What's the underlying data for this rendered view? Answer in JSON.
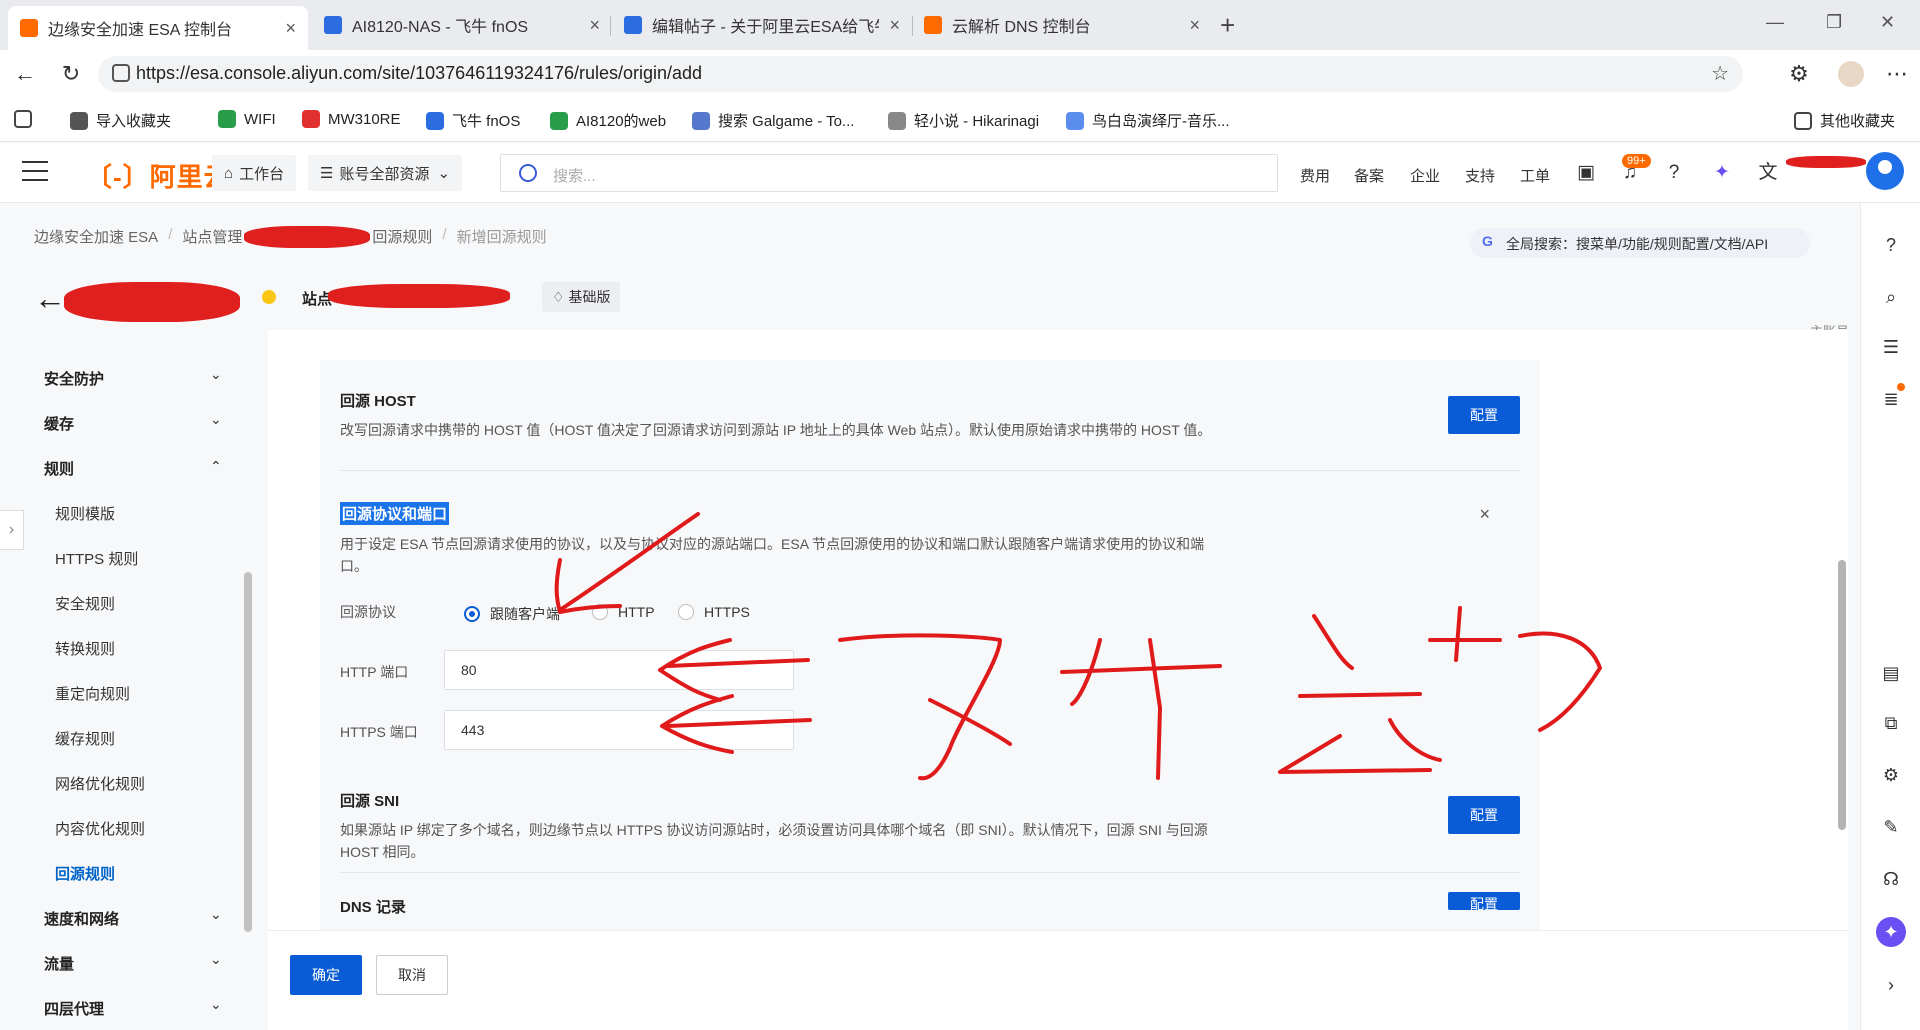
{
  "browser": {
    "tabs": [
      {
        "title": "边缘安全加速 ESA 控制台",
        "color": "#ff6a00",
        "active": true
      },
      {
        "title": "AI8120-NAS - 飞牛 fnOS",
        "color": "#2b6de0",
        "active": false
      },
      {
        "title": "编辑帖子 - 关于阿里云ESA给飞牛N",
        "color": "#2b6de0",
        "active": false
      },
      {
        "title": "云解析 DNS 控制台",
        "color": "#ff6a00",
        "active": false
      }
    ],
    "url": "https://esa.console.aliyun.com/site/1037646119324176/rules/origin/add",
    "bookmarks": [
      {
        "label": "导入收藏夹",
        "color": "#555555"
      },
      {
        "label": "WIFI",
        "color": "#2a9d4b"
      },
      {
        "label": "MW310RE",
        "color": "#e03030"
      },
      {
        "label": "飞牛 fnOS",
        "color": "#2b6de0"
      },
      {
        "label": "AI8120的web",
        "color": "#2a9d4b"
      },
      {
        "label": "搜索 Galgame - To...",
        "color": "#5577cc"
      },
      {
        "label": "轻小说 - Hikarinagi",
        "color": "#888888"
      },
      {
        "label": "鸟白岛演绎厅-音乐...",
        "color": "#5b8def"
      }
    ],
    "bookmarks_other": "其他收藏夹"
  },
  "header": {
    "logo": "〔-〕阿里云",
    "workbench": "工作台",
    "resources": "账号全部资源",
    "search_placeholder": "搜索...",
    "links": [
      "费用",
      "备案",
      "企业",
      "支持",
      "工单"
    ],
    "badge": "99+",
    "subaccount": "主账号",
    "accent": "#ff6a00"
  },
  "breadcrumb": {
    "items": [
      "边缘安全加速 ESA",
      "站点管理",
      "回源规则",
      "新增回源规则"
    ],
    "global_search": "全局搜索：搜菜单/功能/规则配置/文档/API"
  },
  "title": {
    "site_label": "站点",
    "plan": "基础版"
  },
  "sidenav": {
    "sections": [
      {
        "label": "安全防护",
        "expanded": false
      },
      {
        "label": "缓存",
        "expanded": false
      },
      {
        "label": "规则",
        "expanded": true
      },
      {
        "label": "速度和网络",
        "expanded": false
      },
      {
        "label": "流量",
        "expanded": false
      },
      {
        "label": "四层代理",
        "expanded": false
      }
    ],
    "rule_items": [
      "规则模版",
      "HTTPS 规则",
      "安全规则",
      "转换规则",
      "重定向规则",
      "缓存规则",
      "网络优化规则",
      "内容优化规则",
      "回源规则"
    ],
    "active_item": "回源规则"
  },
  "content": {
    "host": {
      "title": "回源 HOST",
      "desc": "改写回源请求中携带的 HOST 值（HOST 值决定了回源请求访问到源站 IP 地址上的具体 Web 站点）。默认使用原始请求中携带的 HOST 值。",
      "button": "配置"
    },
    "protocol": {
      "title": "回源协议和端口",
      "desc": "用于设定 ESA 节点回源请求使用的协议，以及与协议对应的源站端口。ESA 节点回源使用的协议和端口默认跟随客户端请求使用的协议和端口。",
      "close": "×",
      "protocol_label": "回源协议",
      "options": [
        "跟随客户端",
        "HTTP",
        "HTTPS"
      ],
      "selected": "跟随客户端",
      "http_port_label": "HTTP 端口",
      "http_port": "80",
      "https_port_label": "HTTPS 端口",
      "https_port": "443"
    },
    "sni": {
      "title": "回源 SNI",
      "desc": "如果源站 IP 绑定了多个域名，则边缘节点以 HTTPS 协议访问源站时，必须设置访问具体哪个域名（即 SNI）。默认情况下，回源 SNI 与回源 HOST 相同。",
      "button": "配置"
    },
    "dns": {
      "title": "DNS 记录",
      "button": "配置"
    }
  },
  "footer": {
    "ok": "确定",
    "cancel": "取消"
  },
  "annotation": {
    "ink_color": "#e01a1a"
  }
}
